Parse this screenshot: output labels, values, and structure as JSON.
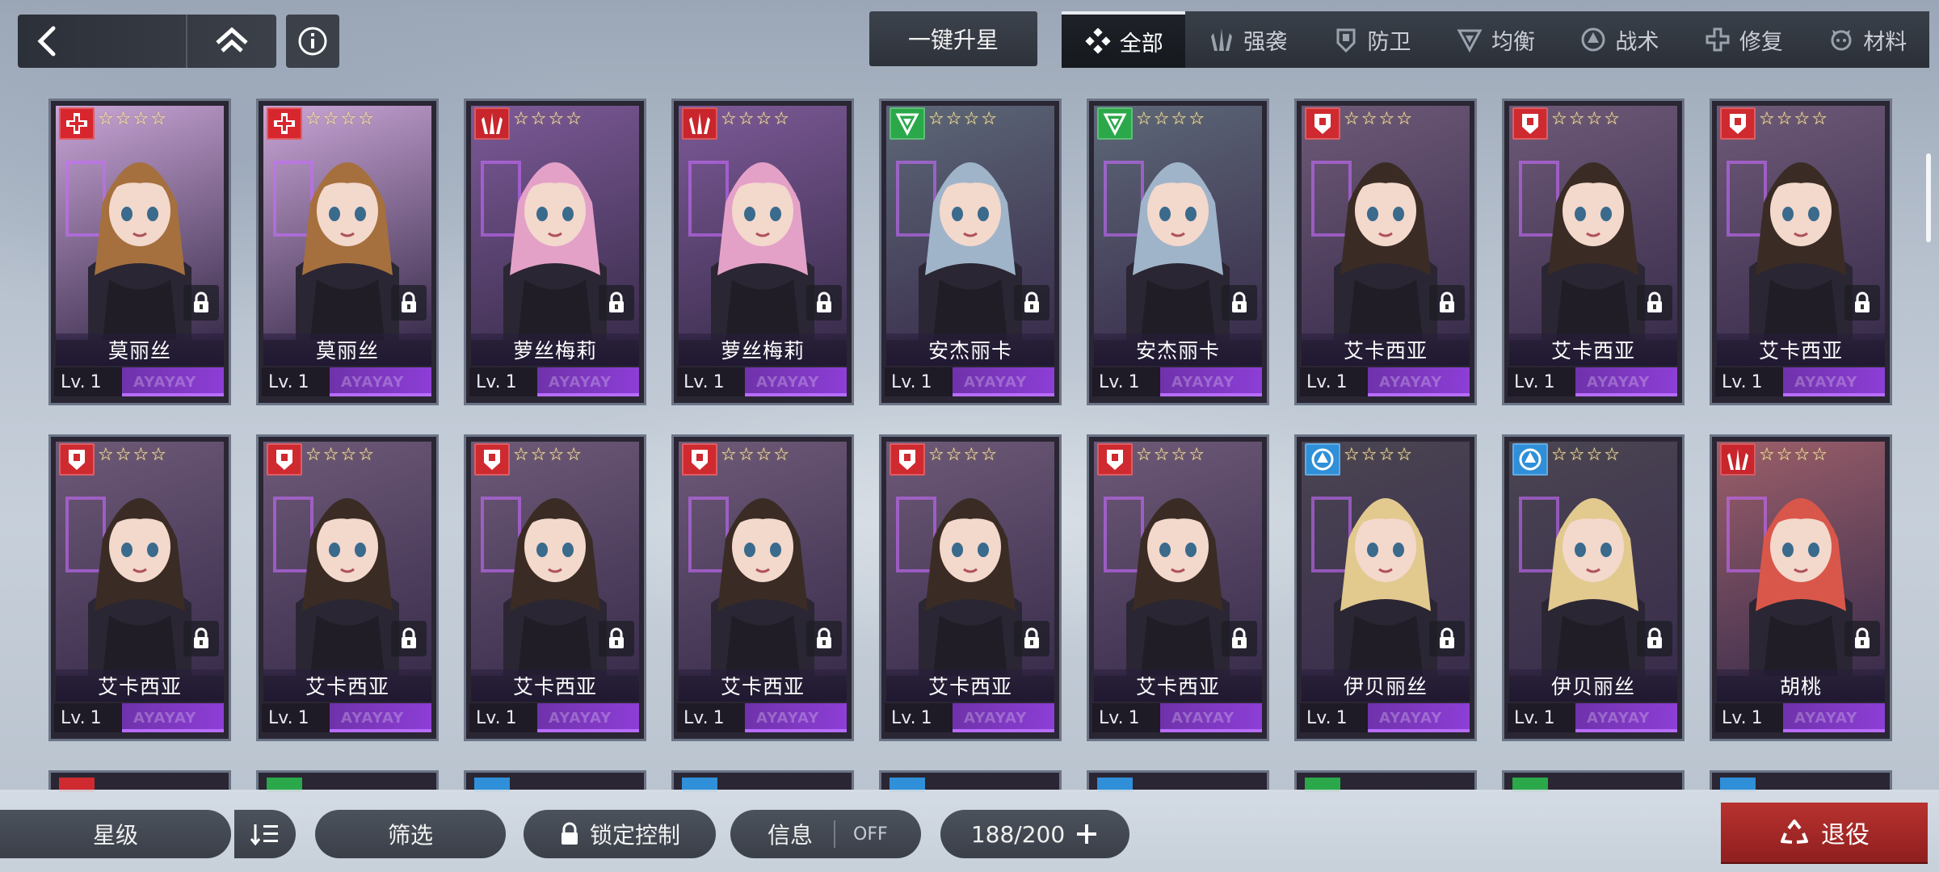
{
  "nav": {
    "back_icon": "chevron-left-icon",
    "home_icon": "home-icon",
    "info_icon": "info-icon"
  },
  "upgrade_label": "一键升星",
  "tabs": [
    {
      "label": "全部",
      "icon": "all-icon",
      "active": true
    },
    {
      "label": "强袭",
      "icon": "assault-icon"
    },
    {
      "label": "防卫",
      "icon": "defense-icon"
    },
    {
      "label": "均衡",
      "icon": "balance-icon"
    },
    {
      "label": "战术",
      "icon": "tactics-icon"
    },
    {
      "label": "修复",
      "icon": "repair-icon"
    },
    {
      "label": "材料",
      "icon": "material-icon"
    }
  ],
  "cards": [
    {
      "name": "莫丽丝",
      "level": "1",
      "class": "repair",
      "hair": "#a5703e",
      "bg": "#c9a5d6"
    },
    {
      "name": "莫丽丝",
      "level": "1",
      "class": "repair",
      "hair": "#a5703e",
      "bg": "#c9a5d6"
    },
    {
      "name": "萝丝梅莉",
      "level": "1",
      "class": "assault",
      "hair": "#e4a1c7",
      "bg": "#7d5a98"
    },
    {
      "name": "萝丝梅莉",
      "level": "1",
      "class": "assault",
      "hair": "#e4a1c7",
      "bg": "#7d5a98"
    },
    {
      "name": "安杰丽卡",
      "level": "1",
      "class": "balance",
      "hair": "#9fb4c9",
      "bg": "#5d6878"
    },
    {
      "name": "安杰丽卡",
      "level": "1",
      "class": "balance",
      "hair": "#9fb4c9",
      "bg": "#5d6878"
    },
    {
      "name": "艾卡西亚",
      "level": "1",
      "class": "defense",
      "hair": "#3a2c24",
      "bg": "#6e5a78"
    },
    {
      "name": "艾卡西亚",
      "level": "1",
      "class": "defense",
      "hair": "#3a2c24",
      "bg": "#6e5a78"
    },
    {
      "name": "艾卡西亚",
      "level": "1",
      "class": "defense",
      "hair": "#3a2c24",
      "bg": "#6e5a78"
    },
    {
      "name": "艾卡西亚",
      "level": "1",
      "class": "defense",
      "hair": "#3a2c24",
      "bg": "#6e5a78"
    },
    {
      "name": "艾卡西亚",
      "level": "1",
      "class": "defense",
      "hair": "#3a2c24",
      "bg": "#6e5a78"
    },
    {
      "name": "艾卡西亚",
      "level": "1",
      "class": "defense",
      "hair": "#3a2c24",
      "bg": "#6e5a78"
    },
    {
      "name": "艾卡西亚",
      "level": "1",
      "class": "defense",
      "hair": "#3a2c24",
      "bg": "#6e5a78"
    },
    {
      "name": "艾卡西亚",
      "level": "1",
      "class": "defense",
      "hair": "#3a2c24",
      "bg": "#6e5a78"
    },
    {
      "name": "艾卡西亚",
      "level": "1",
      "class": "defense",
      "hair": "#3a2c24",
      "bg": "#6e5a78"
    },
    {
      "name": "伊贝丽丝",
      "level": "1",
      "class": "tactics",
      "hair": "#e2c98e",
      "bg": "#4a4552"
    },
    {
      "name": "伊贝丽丝",
      "level": "1",
      "class": "tactics",
      "hair": "#e2c98e",
      "bg": "#4a4552"
    },
    {
      "name": "胡桃",
      "level": "1",
      "class": "assault",
      "hair": "#d9574a",
      "bg": "#9c5f6a"
    }
  ],
  "class_colors": {
    "repair": "#d8262e",
    "assault": "#c9252c",
    "balance": "#2aa84a",
    "defense": "#cf2a30",
    "tactics": "#2f8fd8"
  },
  "peek_colors": [
    "#cf2a30",
    "#2aa84a",
    "#2f8fd8",
    "#2f8fd8",
    "#2f8fd8",
    "#2f8fd8",
    "#2aa84a",
    "#2aa84a",
    "#2f8fd8"
  ],
  "lv_prefix": "Lv.",
  "lv_deco": "AYAYAY",
  "bottom": {
    "star_sort": "星级",
    "filter": "筛选",
    "lock_control": "锁定控制",
    "info": "信息",
    "info_state": "OFF",
    "capacity": "188/200",
    "retire": "退役"
  }
}
